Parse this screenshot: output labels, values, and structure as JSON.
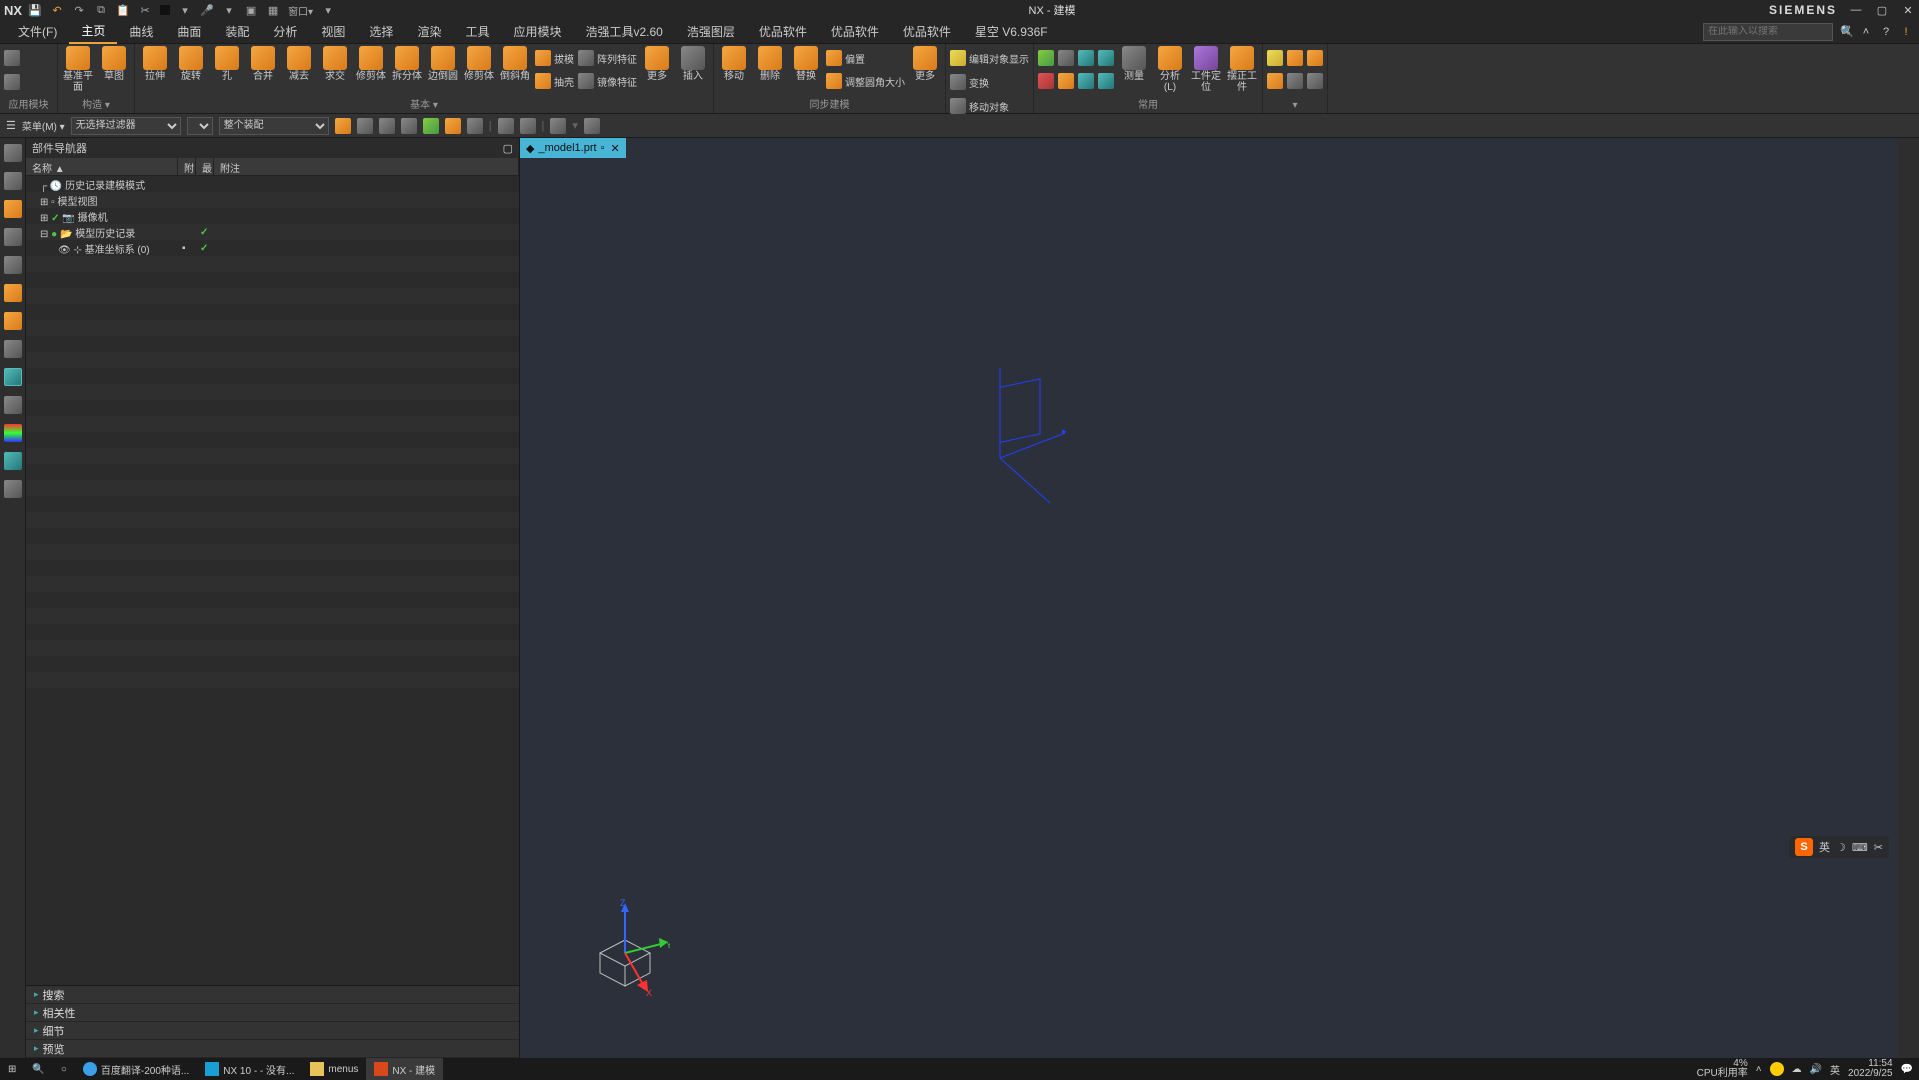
{
  "title": {
    "app": "NX",
    "doc": "NX - 建模",
    "brand": "SIEMENS"
  },
  "menu": {
    "items": [
      "文件(F)",
      "主页",
      "曲线",
      "曲面",
      "装配",
      "分析",
      "视图",
      "选择",
      "渲染",
      "工具",
      "应用模块",
      "浩强工具v2.60",
      "浩强图层",
      "优品软件",
      "优品软件",
      "优品软件",
      "星空 V6.936F"
    ],
    "active": 1,
    "search_placeholder": "在此输入以搜索"
  },
  "ribbon": {
    "g0": {
      "label": "构造",
      "b1": "基准平面",
      "b2": "草图"
    },
    "g1": {
      "label": "基本",
      "b": [
        "拉伸",
        "旋转",
        "孔",
        "合并",
        "减去",
        "求交",
        "修剪体",
        "拆分体",
        "边倒圆",
        "修剪体",
        "倒斜角"
      ],
      "s": [
        "拔模",
        "抽壳",
        "阵列特征",
        "镜像特征"
      ],
      "more": "更多",
      "insert": "插入"
    },
    "g2": {
      "label": "同步建模",
      "b": [
        "移动",
        "删除",
        "替换"
      ],
      "s": [
        "偏置",
        "调整圆角大小"
      ],
      "more": "更多"
    },
    "g3": {
      "label": "",
      "s": [
        "编辑对象显示",
        "变换",
        "移动对象"
      ]
    },
    "g4": {
      "label": "常用",
      "b": [
        "测量",
        "分析(L)",
        "工件定位",
        "摆正工件"
      ]
    },
    "g_app": {
      "label": "应用模块"
    }
  },
  "selbar": {
    "menu": "菜单(M)",
    "filter": "无选择过滤器",
    "assembly": "整个装配"
  },
  "nav": {
    "title": "部件导航器",
    "cols": [
      "名称  ▲",
      "附",
      "最",
      "附注"
    ],
    "rows": [
      {
        "indent": 1,
        "icon": "clock",
        "text": "历史记录建模模式"
      },
      {
        "indent": 1,
        "icon": "folder",
        "text": "模型视图",
        "expand": "+"
      },
      {
        "indent": 1,
        "icon": "cam",
        "text": "摄像机",
        "expand": "+",
        "check": true
      },
      {
        "indent": 1,
        "icon": "hist",
        "text": "模型历史记录",
        "expand": "-",
        "dot": true,
        "c2": "✓"
      },
      {
        "indent": 2,
        "icon": "csys",
        "text": "基准坐标系 (0)",
        "c1": true,
        "c2": "✓"
      }
    ],
    "sections": [
      "搜索",
      "相关性",
      "细节",
      "预览"
    ]
  },
  "tab": {
    "label": "_model1.prt"
  },
  "ime": {
    "lang": "英"
  },
  "taskbar": {
    "items": [
      {
        "icon": "#3aa0e8",
        "label": "百度翻译-200种语..."
      },
      {
        "icon": "#1a9fd4",
        "label": "NX 10 -   - 没有..."
      },
      {
        "icon": "#e8c35a",
        "label": "menus"
      },
      {
        "icon": "#d9481a",
        "label": "NX - 建模",
        "active": true
      }
    ],
    "cpu_pct": "4%",
    "cpu_label": "CPU利用率",
    "ime": "英",
    "time": "11:54",
    "date": "2022/9/25"
  }
}
